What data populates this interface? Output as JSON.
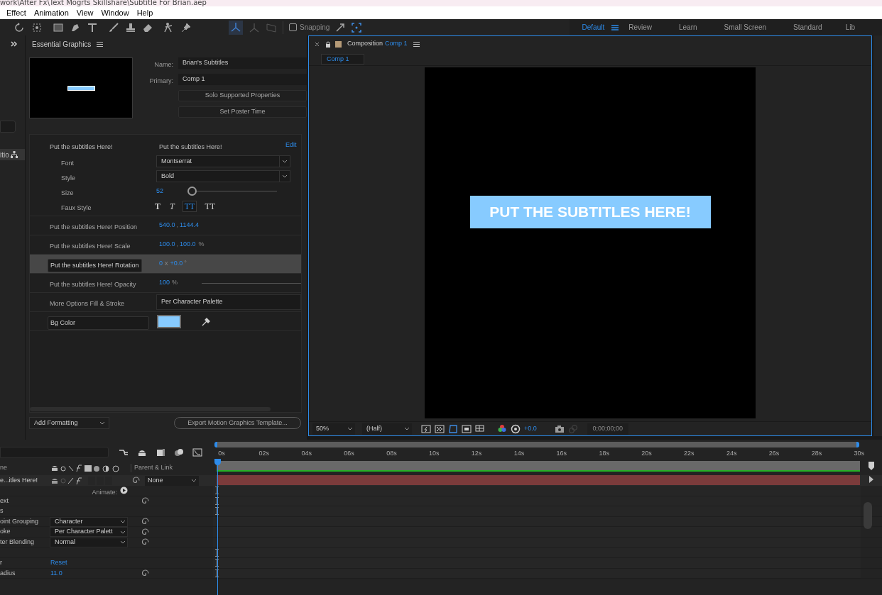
{
  "title_bar": {
    "title": "work\\After Fx\\Text Mogrts Skillshare\\Subtitle For Brian.aep"
  },
  "menu": [
    "Effect",
    "Animation",
    "View",
    "Window",
    "Help"
  ],
  "toolbar": {
    "snapping": {
      "label": "Snapping",
      "checked": false
    }
  },
  "workspaces": [
    {
      "label": "Default",
      "selected": true
    },
    {
      "label": "Review",
      "selected": false
    },
    {
      "label": "Learn",
      "selected": false
    },
    {
      "label": "Small Screen",
      "selected": false
    },
    {
      "label": "Standard",
      "selected": false
    },
    {
      "label": "Lib",
      "selected": false
    }
  ],
  "left_strip": {
    "label": "itio"
  },
  "essential_graphics": {
    "title": "Essential Graphics",
    "name_label": "Name:",
    "name": "Brian's Subtitles",
    "primary_label": "Primary:",
    "primary": "Comp 1",
    "buttons": [
      "Solo Supported Properties",
      "Set Poster Time"
    ],
    "group": {
      "label": "Put the subtitles Here!",
      "value": "Put the subtitles Here!",
      "edit": "Edit"
    },
    "text_props": [
      {
        "kind": "dropdown",
        "label": "Font",
        "value": "Montserrat"
      },
      {
        "kind": "dropdown",
        "label": "Style",
        "value": "Bold"
      },
      {
        "kind": "slider",
        "label": "Size",
        "value": "52",
        "level": 0
      },
      {
        "kind": "faux",
        "label": "Faux Style",
        "styles": [
          {
            "glyph": "T",
            "selected": false
          },
          {
            "glyph": "T",
            "selected": false
          },
          {
            "glyph": "TT",
            "selected": true
          },
          {
            "glyph": "TT",
            "selected": false
          }
        ]
      }
    ],
    "properties": [
      {
        "kind": "pair",
        "label": "Put the subtitles Here! Position",
        "values": [
          "540.0",
          "1144.4"
        ],
        "separator": ",",
        "selected": false
      },
      {
        "kind": "pair",
        "label": "Put the subtitles Here! Scale",
        "values": [
          "100.0",
          "100.0"
        ],
        "separator": ",",
        "unit": "%",
        "selected": false
      },
      {
        "kind": "rotation",
        "label": "Put the subtitles Here! Rotation",
        "values": [
          "0",
          "+0.0"
        ],
        "separator": "x",
        "unit": "°",
        "selected": true
      },
      {
        "kind": "opacity",
        "label": "Put the subtitles Here! Opacity",
        "values": [
          "100"
        ],
        "unit": "%",
        "selected": false
      },
      {
        "kind": "dropdown",
        "label": "More Options Fill & Stroke",
        "value": "Per Character Palette",
        "selected": false
      },
      {
        "kind": "color",
        "label": "Bg Color",
        "color": "#87cbff",
        "selected": false
      }
    ],
    "add_formatting": "Add Formatting",
    "export": "Export Motion Graphics Template..."
  },
  "composition": {
    "tab_label": "Composition",
    "tab_comp": "Comp 1",
    "subtab": "Comp 1",
    "subtitle": "PUT THE SUBTITLES HERE!",
    "zoom": "50%",
    "resolution": "(Half)",
    "exposure": "+0.0",
    "timecode": "0;00;00;00"
  },
  "timeline": {
    "ruler": [
      "0s",
      "02s",
      "04s",
      "06s",
      "08s",
      "10s",
      "12s",
      "14s",
      "16s",
      "18s",
      "20s",
      "22s",
      "24s",
      "26s",
      "28s",
      "30s"
    ],
    "name_column": "ne",
    "parent_column": "Parent & Link",
    "layer": {
      "name": "e...itles Here!",
      "parent": "None"
    },
    "rows": [
      {
        "kind": "animate",
        "value": "Animate:",
        "marker": true,
        "pickwhip": false
      },
      {
        "kind": "plain",
        "name": "ext",
        "marker": true,
        "pickwhip": true
      },
      {
        "kind": "plain",
        "name": "s",
        "marker": true,
        "pickwhip": false
      },
      {
        "kind": "dropdown",
        "name": "oint Grouping",
        "value": "Character",
        "marker": false,
        "pickwhip": true
      },
      {
        "kind": "dropdown",
        "name": "oke",
        "value": "Per Character Palett",
        "marker": false,
        "pickwhip": true
      },
      {
        "kind": "dropdown",
        "name": "ter Blending",
        "value": "Normal",
        "marker": false,
        "pickwhip": true
      },
      {
        "kind": "blank",
        "marker": true,
        "pickwhip": false
      },
      {
        "kind": "link",
        "name": "r",
        "value": "Reset",
        "marker": true,
        "pickwhip": false
      },
      {
        "kind": "number",
        "name": "adius",
        "value": "11.0",
        "marker": true,
        "pickwhip": true
      }
    ]
  }
}
